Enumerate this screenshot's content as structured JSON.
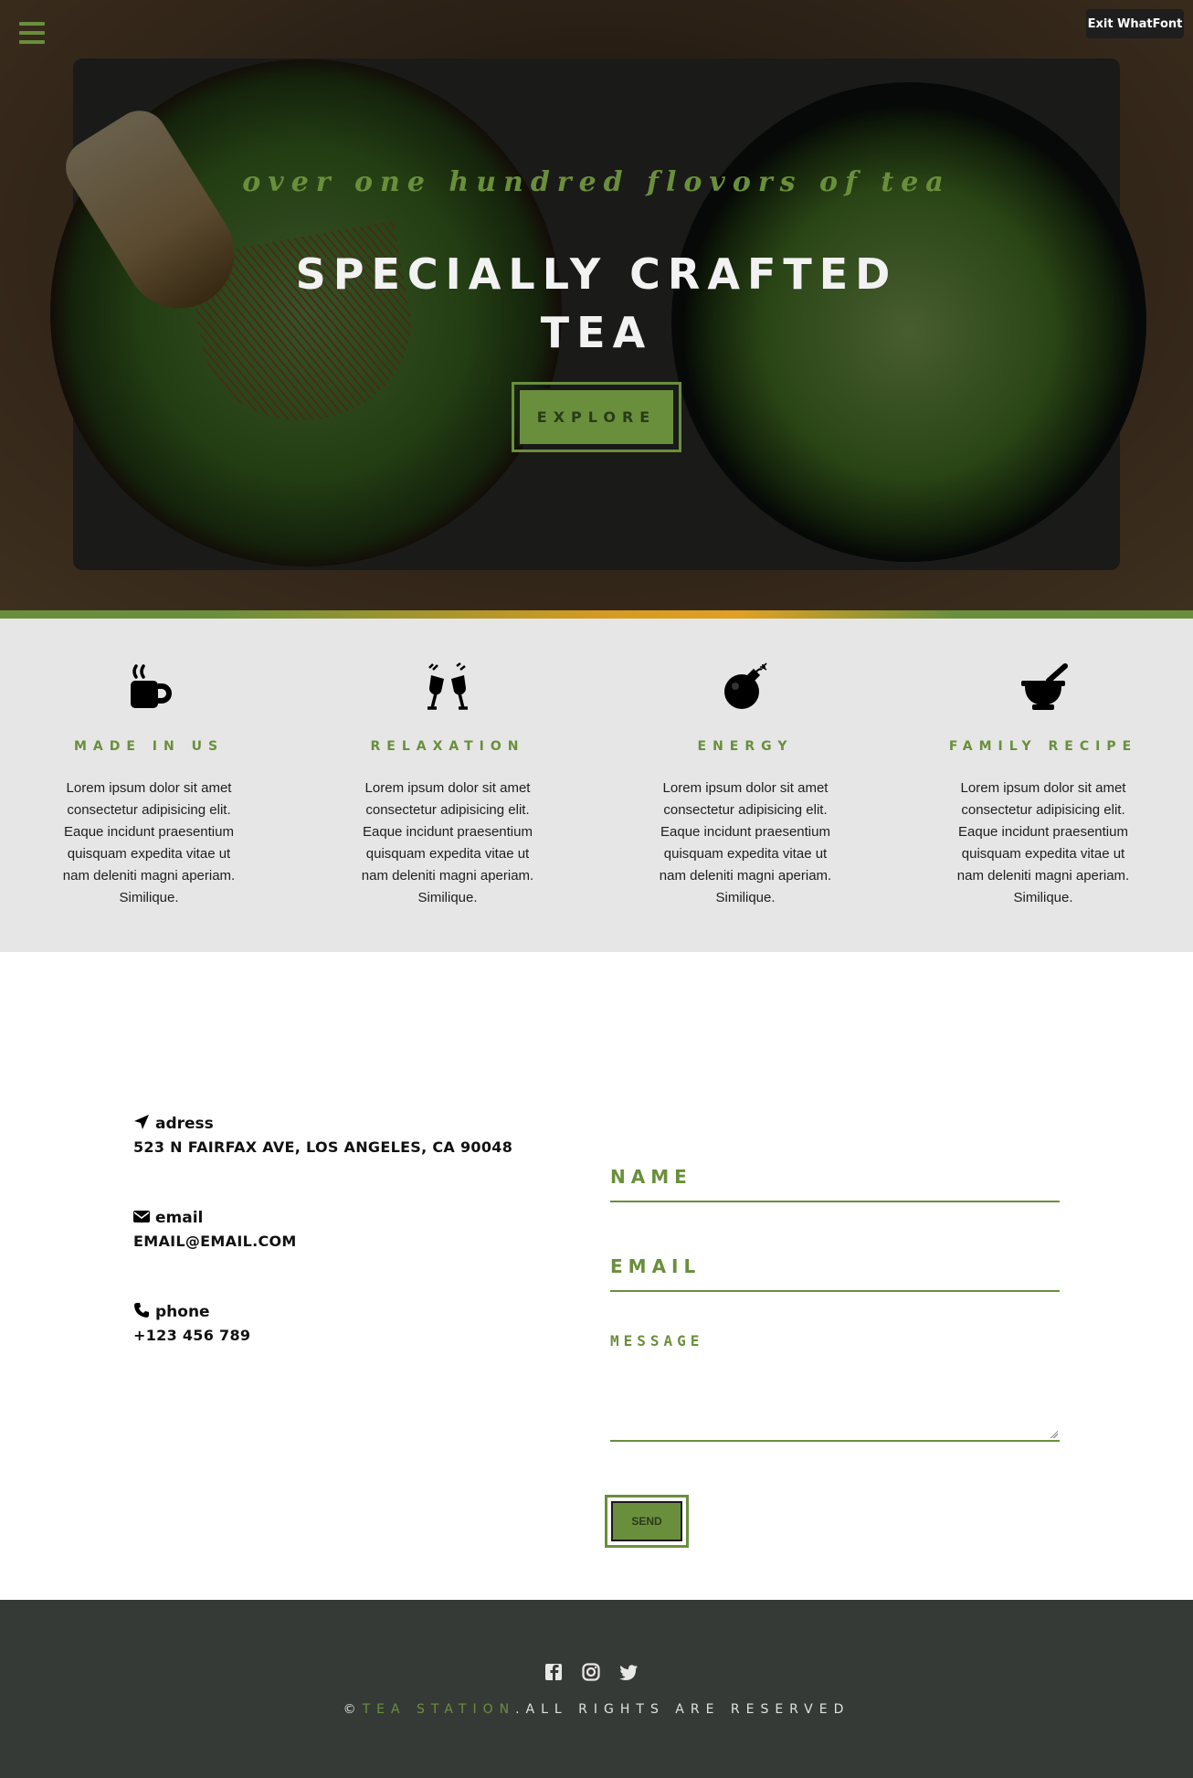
{
  "header": {
    "exit_button": "Exit WhatFont",
    "tagline": "over one hundred flovors of tea",
    "title": "SPECIALLY CRAFTED TEA",
    "explore_button": "EXPLORE"
  },
  "features": [
    {
      "icon": "coffee-cup-icon",
      "title": "MADE IN US",
      "text": "Lorem ipsum dolor sit amet consectetur adipisicing elit. Eaque incidunt praesentium quisquam expedita vitae ut nam deleniti magni aperiam. Similique."
    },
    {
      "icon": "glass-cheers-icon",
      "title": "RELAXATION",
      "text": "Lorem ipsum dolor sit amet consectetur adipisicing elit. Eaque incidunt praesentium quisquam expedita vitae ut nam deleniti magni aperiam. Similique."
    },
    {
      "icon": "bomb-icon",
      "title": "ENERGY",
      "text": "Lorem ipsum dolor sit amet consectetur adipisicing elit. Eaque incidunt praesentium quisquam expedita vitae ut nam deleniti magni aperiam. Similique."
    },
    {
      "icon": "mortar-pestle-icon",
      "title": "FAMILY RECIPE",
      "text": "Lorem ipsum dolor sit amet consectetur adipisicing elit. Eaque incidunt praesentium quisquam expedita vitae ut nam deleniti magni aperiam. Similique."
    }
  ],
  "contact": {
    "address_label": "adress",
    "address_value": "523 N FAIRFAX AVE, LOS ANGELES, CA 90048",
    "email_label": "email",
    "email_value": "EMAIL@EMAIL.COM",
    "phone_label": "phone",
    "phone_value": "+123 456 789"
  },
  "form": {
    "name_placeholder": "NAME",
    "email_placeholder": "EMAIL",
    "message_placeholder": "MESSAGE",
    "send_button": "SEND"
  },
  "footer": {
    "copyright_symbol": "©",
    "brand": "TEA STATION",
    "rights": ".ALL RIGHTS ARE RESERVED",
    "social_icons": [
      "facebook-icon",
      "instagram-icon",
      "twitter-icon"
    ]
  },
  "colors": {
    "accent": "#6a8f3c",
    "footer_bg": "#363a37",
    "features_bg": "#e6e6e6"
  }
}
